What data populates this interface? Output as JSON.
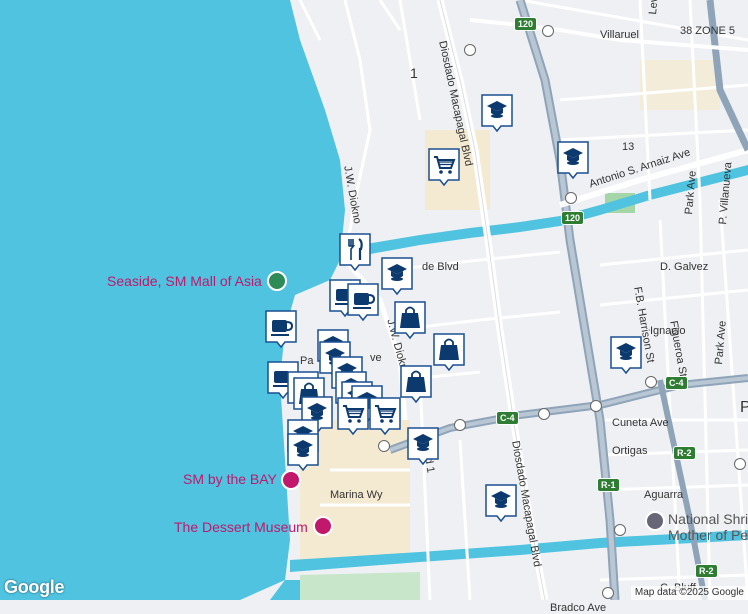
{
  "map": {
    "colors": {
      "water": "#4fc3e0",
      "land": "#eef0f3",
      "road": "#ffffff",
      "highway": "#8fa4b8",
      "green": "#c8e6c9",
      "commercial": "#f5e9c8",
      "marker_border": "#1a4f91",
      "marker_icon": "#0d3a6e"
    },
    "places": {
      "seaside": "Seaside, SM Mall of Asia",
      "sm_bay": "SM by the BAY",
      "dessert": "The Dessert Museum",
      "national_shrine": "National Shri",
      "mother_of_pe": "Mother of Pe"
    },
    "streets": {
      "villaruel": "Villaruel",
      "zone": "38 ZONE 5",
      "leveriza": "Leveriza",
      "diosdado_top": "Diosdado Macapagal Blvd",
      "diosdado_bottom": "Diosdado Macapagal Blvd",
      "jw_diokno_top": "J.W. Diokno",
      "jw_diokno_mid": "J.W. Diokno",
      "arnaiz": "Antonio S. Arnaiz Ave",
      "p_villanueva": "P. Villanueva",
      "park_ave_1": "Park Ave",
      "park_ave_2": "Park Ave",
      "d_galvez": "D. Galvez",
      "figueroa": "Figueroa St",
      "fb_harrison": "F.B. Harrison St",
      "ignacio": "Ignacio",
      "cuneta": "Cuneta Ave",
      "ortigas": "Ortigas",
      "aguarra": "Aguarra",
      "marina": "Marina Wy",
      "bradco": "Bradco Ave",
      "seaside_blvd": "de Blvd",
      "pa_ave": "Pa",
      "ve": "ve",
      "rd1": "a Rd 1",
      "c_bluff": "C. Bluff"
    },
    "area_labels": {
      "one": "1",
      "thirteen": "13",
      "p_edge": "P"
    },
    "shields": {
      "s120a": "120",
      "s120b": "120",
      "c4a": "C-4",
      "c4b": "C-4",
      "r2a": "R-2",
      "r2b": "R-2",
      "r1": "R-1"
    },
    "branding": {
      "logo": "Google",
      "attribution": "Map data ©2025 Google"
    },
    "marker_icons": [
      "school-icon",
      "shopping-cart-icon",
      "restaurant-icon",
      "cafe-icon",
      "shopping-bag-icon"
    ]
  }
}
